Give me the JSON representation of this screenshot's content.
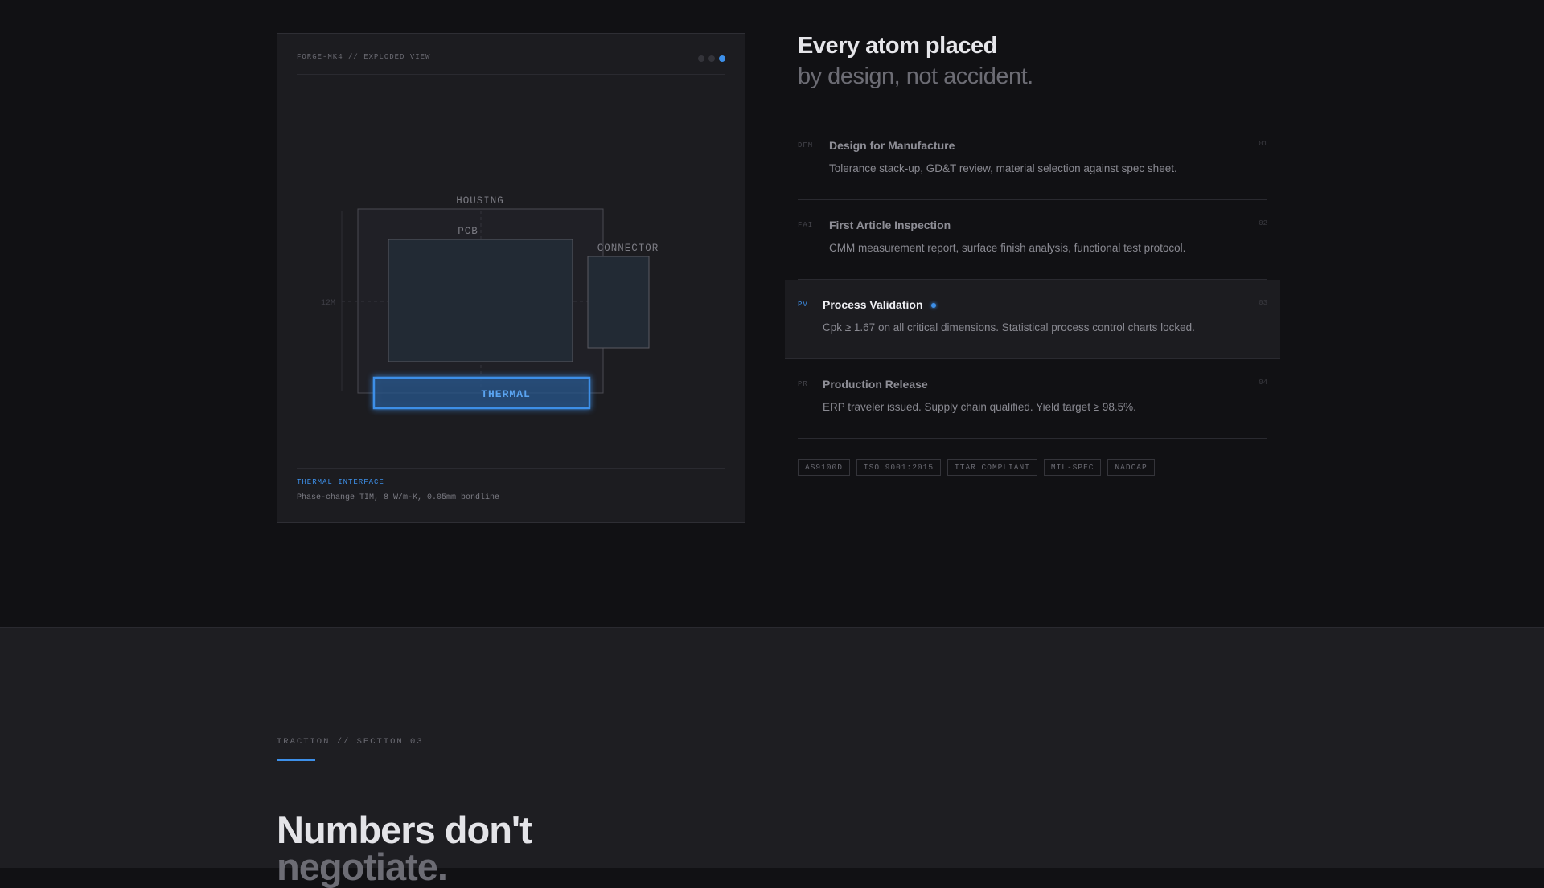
{
  "visualizer": {
    "header_label": "FORGE-MK4 // EXPLODED VIEW",
    "components": {
      "housing": "HOUSING",
      "pcb": "PCB",
      "connector": "CONNECTOR",
      "thermal": "THERMAL",
      "dimension": "12M"
    },
    "step_dots": {
      "count": 3,
      "active_index": 2
    },
    "caption_title": "THERMAL INTERFACE",
    "caption_text": "Phase-change TIM, 8 W/m-K, 0.05mm bondline",
    "accent_color": "#3d8fe8"
  },
  "hero": {
    "title": "Every atom placed",
    "subtitle": "by design, not accident."
  },
  "process": [
    {
      "abbr": "DFM",
      "title": "Design for Manufacture",
      "description": "Tolerance stack-up, GD&T review, material selection against spec sheet.",
      "number": "01",
      "active": false
    },
    {
      "abbr": "FAI",
      "title": "First Article Inspection",
      "description": "CMM measurement report, surface finish analysis, functional test protocol.",
      "number": "02",
      "active": false
    },
    {
      "abbr": "PV",
      "title": "Process Validation",
      "description": "Cpk ≥ 1.67 on all critical dimensions. Statistical process control charts locked.",
      "number": "03",
      "active": true
    },
    {
      "abbr": "PR",
      "title": "Production Release",
      "description": "ERP traveler issued. Supply chain qualified. Yield target ≥ 98.5%.",
      "number": "04",
      "active": false
    }
  ],
  "certifications": [
    "AS9100D",
    "ISO 9001:2015",
    "ITAR COMPLIANT",
    "MIL-SPEC",
    "NADCAP"
  ],
  "traction": {
    "section_label": "TRACTION // SECTION 03",
    "title_line1": "Numbers don't",
    "title_line2": "negotiate."
  }
}
